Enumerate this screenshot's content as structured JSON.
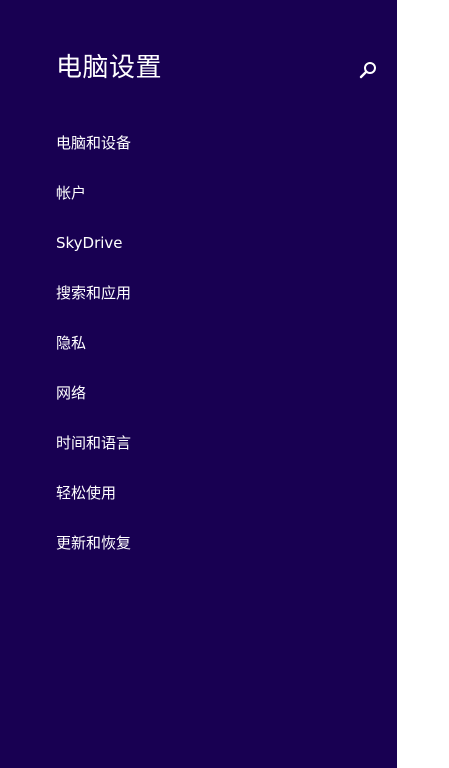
{
  "header": {
    "title": "电脑设置"
  },
  "icons": {
    "search": "search-icon"
  },
  "nav": {
    "items": [
      {
        "label": "电脑和设备"
      },
      {
        "label": "帐户"
      },
      {
        "label": "SkyDrive"
      },
      {
        "label": "搜索和应用"
      },
      {
        "label": "隐私"
      },
      {
        "label": "网络"
      },
      {
        "label": "时间和语言"
      },
      {
        "label": "轻松使用"
      },
      {
        "label": "更新和恢复"
      }
    ]
  },
  "colors": {
    "panel_background": "#180052",
    "text": "#ffffff",
    "page_background": "#ffffff"
  }
}
